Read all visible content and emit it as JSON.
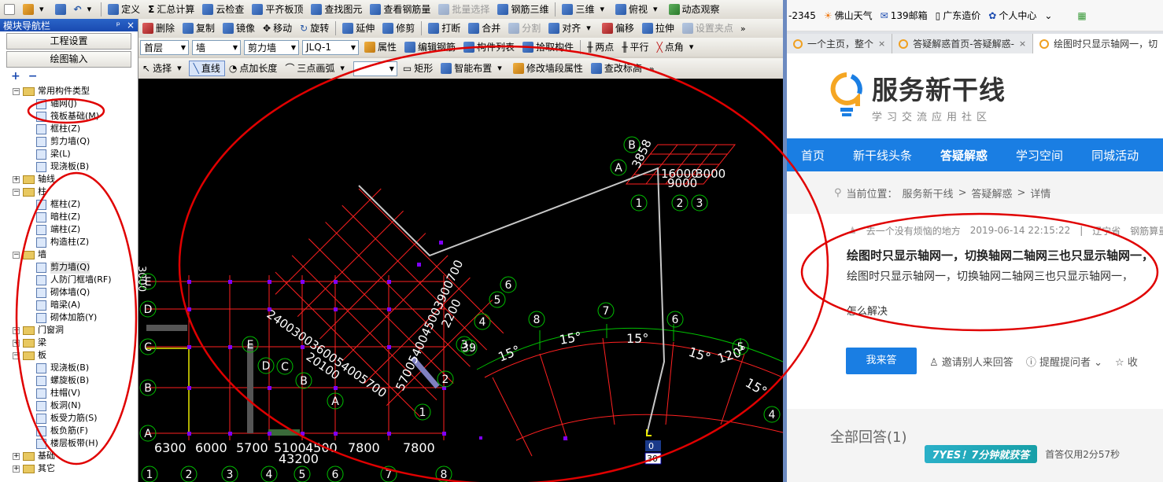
{
  "app": {
    "toolbar1": {
      "items": [
        "定义",
        "汇总计算",
        "云检查",
        "平齐板顶",
        "查找图元",
        "查看钢筋量",
        "批量选择",
        "钢筋三维",
        "三维",
        "俯视",
        "动态观察"
      ]
    },
    "toolbar2": {
      "items": [
        "删除",
        "复制",
        "镜像",
        "移动",
        "旋转",
        "延伸",
        "修剪",
        "打断",
        "合并",
        "分割",
        "对齐",
        "偏移",
        "拉伸",
        "设置夹点"
      ]
    },
    "toolbar3": {
      "floor": "首层",
      "type": "墙",
      "subtype": "剪力墙",
      "element": "JLQ-1",
      "items": [
        "属性",
        "编辑钢筋",
        "构件列表",
        "拾取构件",
        "两点",
        "平行",
        "点角"
      ]
    },
    "toolbar4": {
      "items": [
        "选择",
        "直线",
        "点加长度",
        "三点画弧",
        "矩形",
        "智能布置",
        "修改墙段属性",
        "查改标高"
      ]
    },
    "panel": {
      "title": "模块导航栏",
      "pin": "ᵖ",
      "close": "×",
      "btn_project": "工程设置",
      "btn_draw": "绘图输入",
      "tree": [
        {
          "level": 0,
          "toggle": "−",
          "folder": true,
          "label": "常用构件类型"
        },
        {
          "level": 1,
          "label": "轴网(J)"
        },
        {
          "level": 1,
          "label": "筏板基础(M)"
        },
        {
          "level": 1,
          "label": "框柱(Z)"
        },
        {
          "level": 1,
          "label": "剪力墙(Q)"
        },
        {
          "level": 1,
          "label": "梁(L)"
        },
        {
          "level": 1,
          "label": "现浇板(B)"
        },
        {
          "level": 0,
          "toggle": "+",
          "folder": true,
          "label": "轴线"
        },
        {
          "level": 0,
          "toggle": "−",
          "folder": true,
          "label": "柱"
        },
        {
          "level": 1,
          "label": "框柱(Z)"
        },
        {
          "level": 1,
          "label": "暗柱(Z)"
        },
        {
          "level": 1,
          "label": "端柱(Z)"
        },
        {
          "level": 1,
          "label": "构造柱(Z)"
        },
        {
          "level": 0,
          "toggle": "−",
          "folder": true,
          "label": "墙"
        },
        {
          "level": 1,
          "label": "剪力墙(Q)",
          "current": true
        },
        {
          "level": 1,
          "label": "人防门框墙(RF)"
        },
        {
          "level": 1,
          "label": "砌体墙(Q)"
        },
        {
          "level": 1,
          "label": "暗梁(A)"
        },
        {
          "level": 1,
          "label": "砌体加筋(Y)"
        },
        {
          "level": 0,
          "toggle": "+",
          "folder": true,
          "label": "门窗洞"
        },
        {
          "level": 0,
          "toggle": "+",
          "folder": true,
          "label": "梁"
        },
        {
          "level": 0,
          "toggle": "−",
          "folder": true,
          "label": "板"
        },
        {
          "level": 1,
          "label": "现浇板(B)"
        },
        {
          "level": 1,
          "label": "螺旋板(B)"
        },
        {
          "level": 1,
          "label": "柱帽(V)"
        },
        {
          "level": 1,
          "label": "板洞(N)"
        },
        {
          "level": 1,
          "label": "板受力筋(S)"
        },
        {
          "level": 1,
          "label": "板负筋(F)"
        },
        {
          "level": 1,
          "label": "楼层板带(H)"
        },
        {
          "level": 0,
          "toggle": "+",
          "folder": true,
          "label": "基础"
        },
        {
          "level": 0,
          "toggle": "+",
          "folder": true,
          "label": "其它"
        }
      ]
    },
    "canvas": {
      "bottom_dims": [
        "6300",
        "6000",
        "5700",
        "5100",
        "4500",
        "7800",
        "7800"
      ],
      "total_dim": "43200",
      "axis_numbers_bottom": [
        "1",
        "2",
        "3",
        "4",
        "5",
        "6",
        "7",
        "8"
      ],
      "axis_letters_left": [
        "E",
        "D",
        "C",
        "B",
        "A"
      ],
      "rotated_dims_top": "16000",
      "rotated_dims_top2": "3000",
      "rotated_dims_top3": "9000",
      "rotated_dim_vert": "3858",
      "rotated_dims_mid": "2400300360054005700",
      "rotated_dims_mid2": "20100",
      "rotated_dims_right": "5700540045003900700",
      "rotated_dim_small": "2200",
      "arc_angles": [
        "15°",
        "15°",
        "15°",
        "15°",
        "120°",
        "15°"
      ],
      "arc_axes": [
        "8",
        "7",
        "6",
        "5",
        "4",
        "39"
      ],
      "tilted_axes_right": [
        "6",
        "5",
        "4",
        "3",
        "2",
        "1"
      ],
      "tilted_axes_bl": [
        "E",
        "D",
        "C",
        "B",
        "A"
      ],
      "top_axes": [
        "B",
        "A"
      ],
      "top_axis_nums": [
        "1",
        "2",
        "3"
      ],
      "coord_box": [
        "0",
        "30"
      ],
      "left_clip": "3000"
    }
  },
  "browser": {
    "bookmarks": [
      "-2345",
      "佛山天气",
      "139邮箱",
      "广东造价",
      "个人中心"
    ],
    "tabs": [
      {
        "label": "一个主页，整个",
        "close": "×"
      },
      {
        "label": "答疑解惑首页-答疑解惑-",
        "close": "×"
      },
      {
        "label": "绘图时只显示轴网一，切",
        "close": "×",
        "active": true
      }
    ],
    "logo": {
      "title": "服务新干线",
      "subtitle": "学习交流应用社区"
    },
    "nav": [
      "首页",
      "新干线头条",
      "答疑解惑",
      "学习空间",
      "同城活动"
    ],
    "breadcrumb": {
      "label": "当前位置：",
      "items": [
        "服务新干线",
        ">",
        "答疑解惑",
        ">",
        "详情"
      ]
    },
    "question": {
      "author": "去一个没有烦恼的地方",
      "date": "2019-06-14 22:15:22",
      "divider": "|",
      "region": "辽宁省",
      "category": "钢筋算量",
      "title": "绘图时只显示轴网一，切换轴网二轴网三也只显示轴网一，",
      "body": "绘图时只显示轴网一，切换轴网二轴网三也只显示轴网一，",
      "extra": "怎么解决"
    },
    "actions": {
      "answer": "我来答",
      "invite": "邀请别人来回答",
      "remind": "提醒提问者",
      "collect": "收"
    },
    "answers": {
      "title": "全部回答(1)",
      "badge": "7YES！7分钟就获答",
      "note": "首答仅用2分57秒"
    }
  },
  "colors": {
    "accent": "#1a7ee3",
    "cad_bg": "#000000",
    "annotation": "#e00000",
    "grid": "#ff2020",
    "arc": "#00c000",
    "panel_title": "#2a64c8"
  }
}
